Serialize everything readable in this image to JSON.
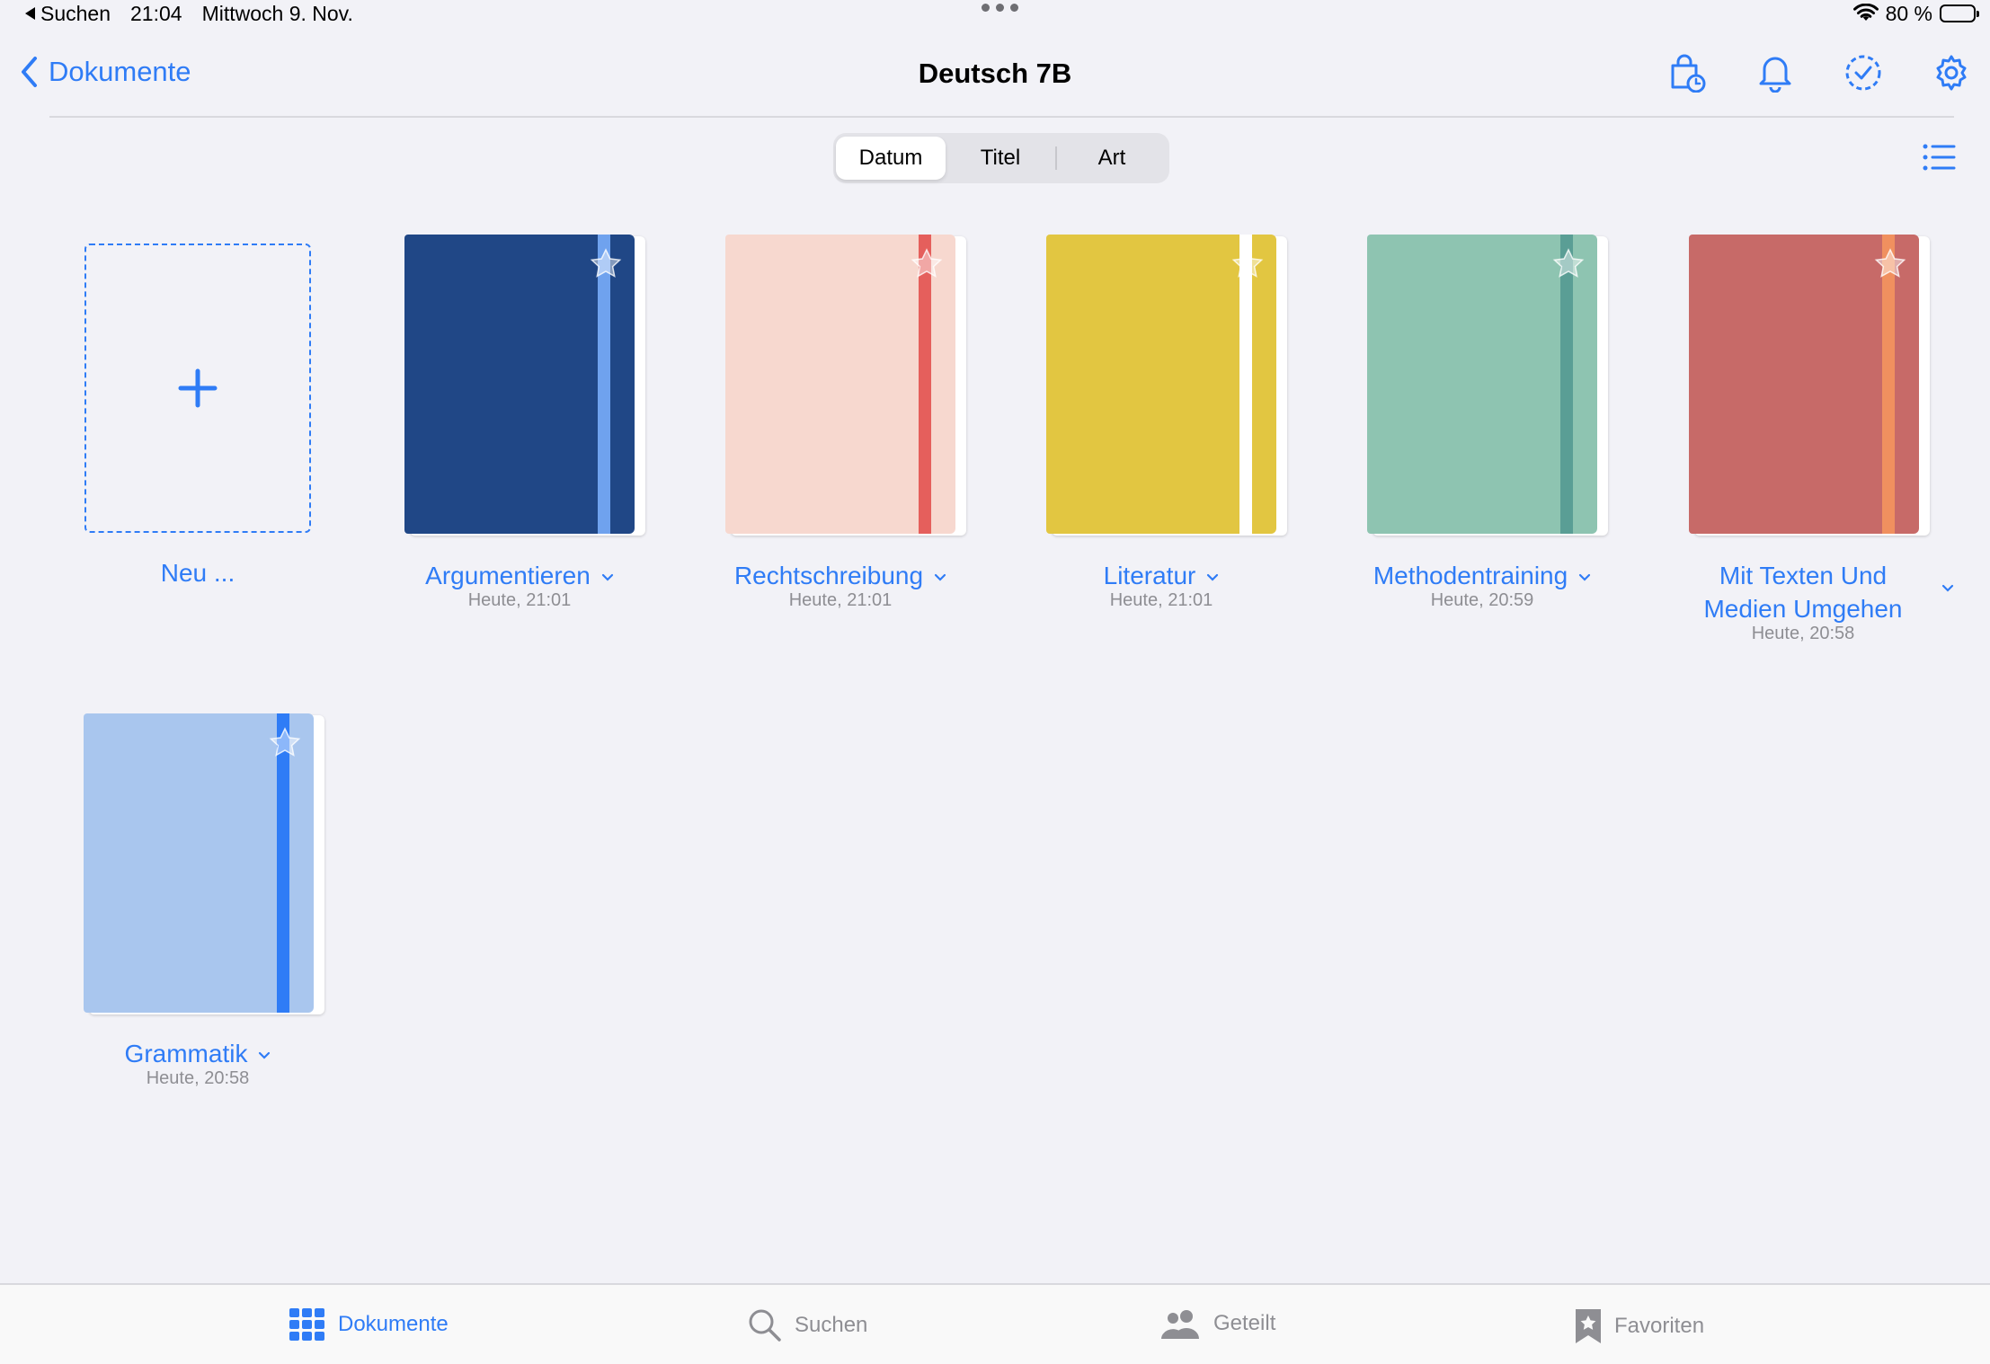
{
  "status_bar": {
    "back_app": "Suchen",
    "time": "21:04",
    "date": "Mittwoch 9. Nov.",
    "battery": "80 %",
    "battery_level": 0.8
  },
  "nav": {
    "back_label": "Dokumente",
    "title": "Deutsch 7B"
  },
  "sort": {
    "options": [
      "Datum",
      "Titel",
      "Art"
    ],
    "selected": "Datum"
  },
  "new_item": {
    "label": "Neu ..."
  },
  "notebooks": [
    {
      "title": "Argumentieren",
      "date": "Heute, 21:01",
      "cover": "#204786",
      "band": "#6FA2EE"
    },
    {
      "title": "Rechtschreibung",
      "date": "Heute, 21:01",
      "cover": "#F7D8CF",
      "band": "#E55F5C"
    },
    {
      "title": "Literatur",
      "date": "Heute, 21:01",
      "cover": "#E2C641",
      "band": "#FFFFFF"
    },
    {
      "title": "Methodentraining",
      "date": "Heute, 20:59",
      "cover": "#8EC4B1",
      "band": "#5A9E95"
    },
    {
      "title_line1": "Mit Texten Und",
      "title_line2": "Medien Umgehen",
      "date": "Heute, 20:58",
      "cover": "#C76A68",
      "band": "#F0905F"
    },
    {
      "title": "Grammatik",
      "date": "Heute, 20:58",
      "cover": "#A9C6EE",
      "band": "#2F7CF6"
    }
  ],
  "tabbar": {
    "items": [
      {
        "label": "Dokumente",
        "icon": "grid-icon",
        "active": true
      },
      {
        "label": "Suchen",
        "icon": "search-icon",
        "active": false
      },
      {
        "label": "Geteilt",
        "icon": "people-icon",
        "active": false
      },
      {
        "label": "Favoriten",
        "icon": "bookmark-star-icon",
        "active": false
      }
    ]
  },
  "colors": {
    "accent": "#2F7CF6",
    "background": "#F2F2F7",
    "secondary_text": "#8E8E93"
  }
}
